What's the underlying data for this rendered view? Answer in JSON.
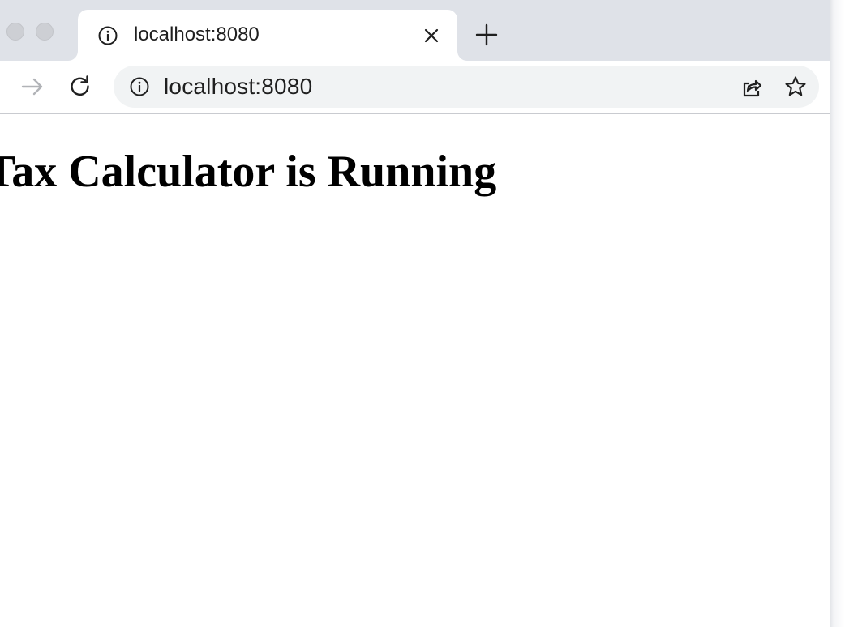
{
  "browser": {
    "tab": {
      "title": "localhost:8080",
      "icon": "info-icon",
      "close_icon": "close-icon"
    },
    "new_tab_icon": "plus-icon",
    "toolbar": {
      "forward_icon": "arrow-right-icon",
      "reload_icon": "reload-icon"
    },
    "omnibox": {
      "url": "localhost:8080",
      "site_info_icon": "info-icon",
      "share_icon": "share-icon",
      "bookmark_icon": "star-icon"
    }
  },
  "page": {
    "heading": "Tax Calculator is Running"
  },
  "colors": {
    "tabstrip": "#dfe2e8",
    "omnibox": "#f1f3f4",
    "text": "#1f1f1f",
    "disabled_icon": "#b1b3b7"
  }
}
